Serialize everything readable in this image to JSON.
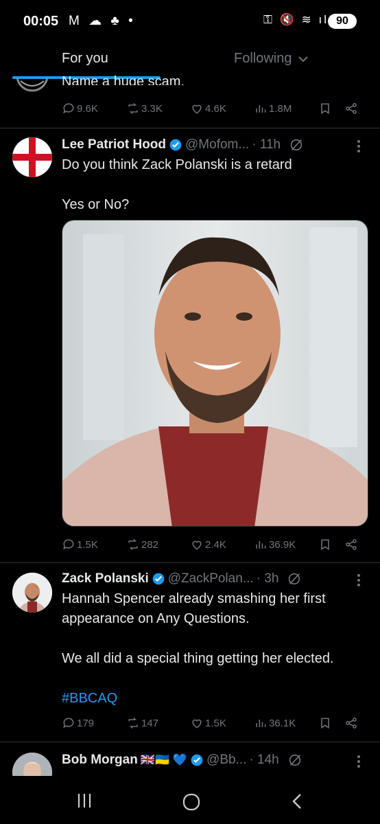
{
  "status_bar": {
    "time": "00:05",
    "left_icons": "M ☁ ♣ •",
    "right_icons": "⚿ 🔇 ≋ ıl",
    "battery": "90"
  },
  "tabs": {
    "for_you": "For you",
    "following": "Following"
  },
  "colors": {
    "accent": "#1d9bf0",
    "muted": "#71767b",
    "text": "#e7e9ea",
    "background": "#000000"
  },
  "partial_tweet": {
    "text": "Name a huge scam.",
    "stats": {
      "replies": "9.6K",
      "reposts": "3.3K",
      "likes": "4.6K",
      "views": "1.8M"
    }
  },
  "tweets": [
    {
      "name": "Lee Patriot Hood",
      "handle": "@Mofom...",
      "time": "· 11h",
      "text_line1": "Do you think Zack Polanski is a retard",
      "text_line2": "Yes or No?",
      "stats": {
        "replies": "1.5K",
        "reposts": "282",
        "likes": "2.4K",
        "views": "36.9K"
      }
    },
    {
      "name": "Zack Polanski",
      "handle": "@ZackPolan...",
      "time": "· 3h",
      "text_line1": "Hannah Spencer already smashing her first appearance on Any Questions.",
      "text_line2": "We all did a special thing getting her elected.",
      "hashtag": "#BBCAQ",
      "stats": {
        "replies": "179",
        "reposts": "147",
        "likes": "1.5K",
        "views": "36.1K"
      }
    },
    {
      "name": "Bob Morgan",
      "flags": "🇬🇧🇺🇦 💙",
      "handle": "@Bb...",
      "time": "· 14h"
    }
  ],
  "icons": [
    "search-icon"
  ]
}
